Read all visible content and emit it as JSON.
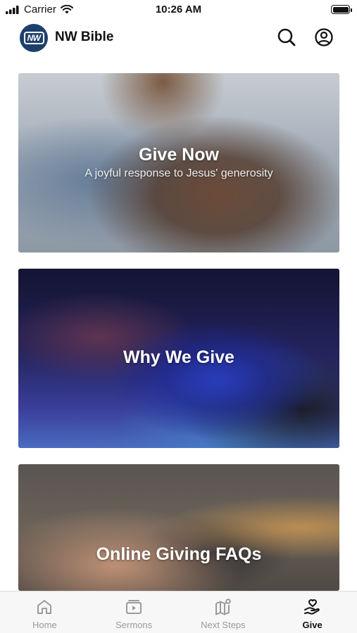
{
  "status_bar": {
    "carrier": "Carrier",
    "time": "10:26 AM"
  },
  "header": {
    "logo_text": "NW",
    "title": "NW Bible"
  },
  "cards": [
    {
      "title": "Give Now",
      "subtitle": "A joyful response to Jesus' generosity"
    },
    {
      "title": "Why We Give"
    },
    {
      "title": "Online Giving FAQs"
    }
  ],
  "tab_bar": {
    "items": [
      {
        "label": "Home",
        "icon": "home-icon"
      },
      {
        "label": "Sermons",
        "icon": "video-icon"
      },
      {
        "label": "Next Steps",
        "icon": "map-pin-icon"
      },
      {
        "label": "Give",
        "icon": "hand-heart-icon"
      }
    ],
    "active_index": 3
  },
  "colors": {
    "logo_bg": "#1e3f6b",
    "active_tab": "#111111",
    "inactive_tab": "#9a9a9a"
  }
}
